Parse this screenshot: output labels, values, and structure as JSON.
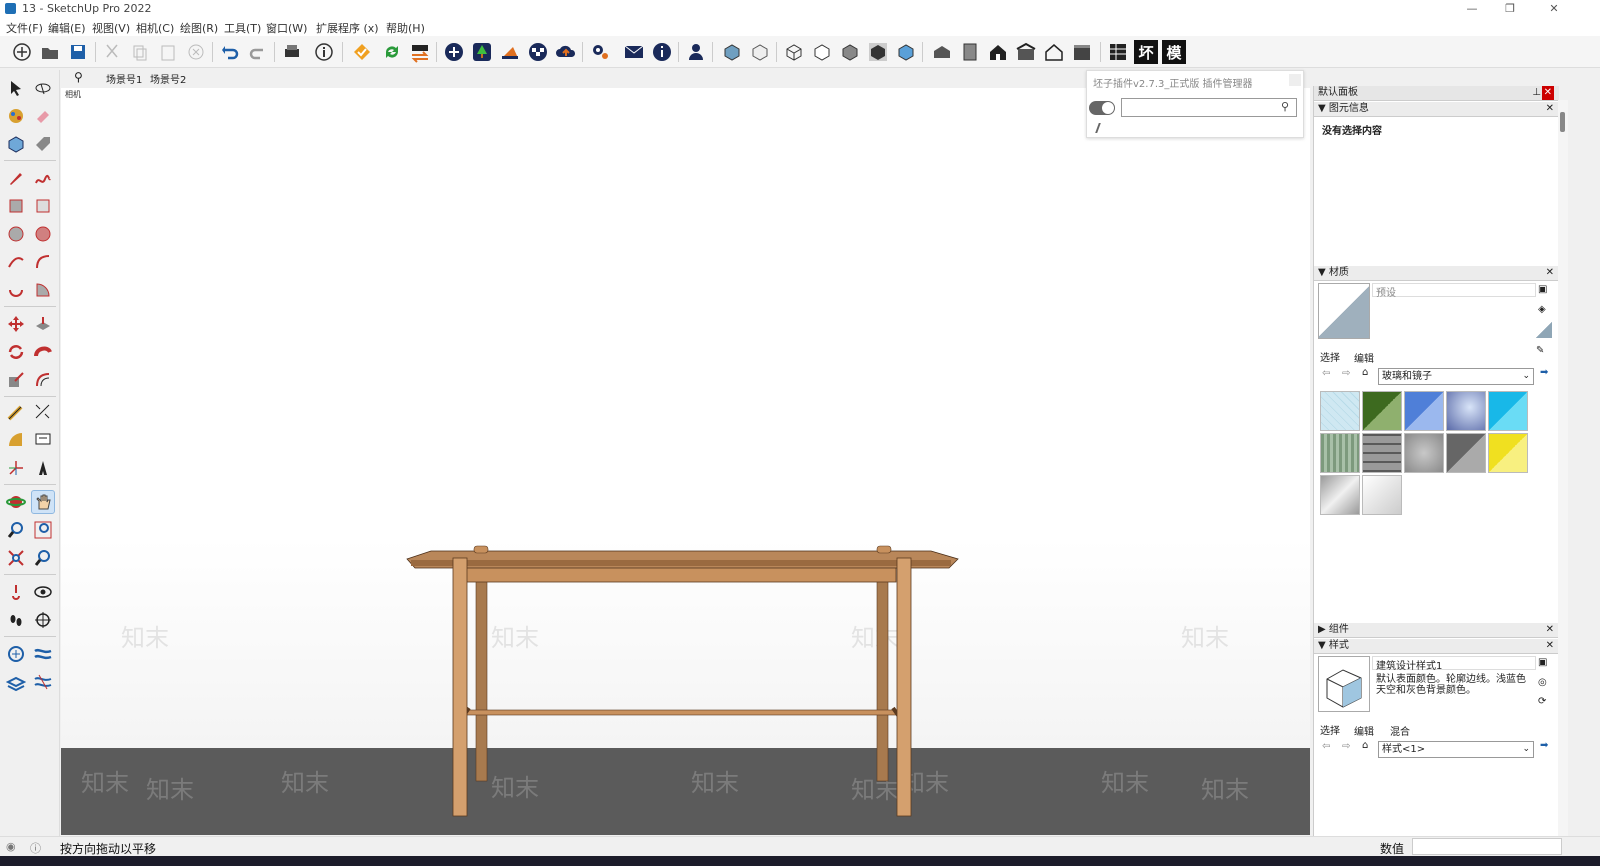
{
  "window": {
    "title": "13 - SketchUp Pro 2022"
  },
  "menu": [
    "文件(F)",
    "编辑(E)",
    "视图(V)",
    "相机(C)",
    "绘图(R)",
    "工具(T)",
    "窗口(W)",
    "扩展程序 (x)",
    "帮助(H)"
  ],
  "toolbar": {
    "right_labels": [
      "坏",
      "模"
    ]
  },
  "scenes": {
    "tabs": [
      "场景号1",
      "场景号2"
    ],
    "viewport_label": "相机"
  },
  "watermark": "知末",
  "plugin": {
    "title": "坯子插件v2.7.3_正式版 插件管理器",
    "search_value": ""
  },
  "tray": {
    "title": "默认面板",
    "entity_info": {
      "header": "图元信息",
      "text": "没有选择内容"
    },
    "materials": {
      "header": "材质",
      "name_value": "预设",
      "tabs": [
        "选择",
        "编辑"
      ],
      "collection": "玻璃和镜子",
      "swatch_colors": [
        [
          "#cfe8f2",
          "#5a7a3a",
          "#7fa3e0",
          "#6f7fb8",
          "#44c7ea"
        ],
        [
          "#8fa88f",
          "#6e6e6e",
          "#b0b0b0",
          "#888888",
          "#f3e64a"
        ],
        [
          "#c8c8c8",
          "#e8e8e8"
        ]
      ]
    },
    "components": {
      "header": "组件"
    },
    "styles": {
      "header": "样式",
      "style_name": "建筑设计样式1",
      "description": "默认表面颜色。轮廓边线。浅蓝色天空和灰色背景颜色。",
      "tabs": [
        "选择",
        "编辑",
        "混合"
      ],
      "collection": "样式<1>"
    }
  },
  "status": {
    "message": "按方向拖动以平移",
    "value_label": "数值",
    "value": ""
  }
}
